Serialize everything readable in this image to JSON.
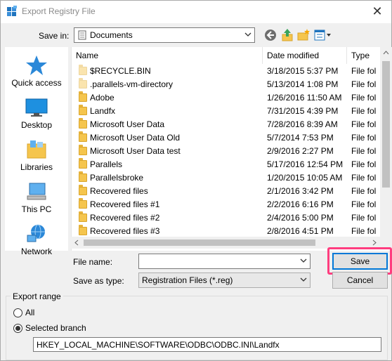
{
  "window": {
    "title": "Export Registry File",
    "close_symbol": "✕"
  },
  "save_in": {
    "label": "Save in:",
    "value": "Documents"
  },
  "places": [
    {
      "id": "quick-access",
      "label": "Quick access"
    },
    {
      "id": "desktop",
      "label": "Desktop"
    },
    {
      "id": "libraries",
      "label": "Libraries"
    },
    {
      "id": "this-pc",
      "label": "This PC"
    },
    {
      "id": "network",
      "label": "Network"
    }
  ],
  "columns": {
    "name": "Name",
    "date": "Date modified",
    "type": "Type"
  },
  "files": [
    {
      "name": "$RECYCLE.BIN",
      "date": "3/18/2015 5:37 PM",
      "type": "File fol",
      "hidden": true
    },
    {
      "name": ".parallels-vm-directory",
      "date": "5/13/2014 1:08 PM",
      "type": "File fol",
      "hidden": true
    },
    {
      "name": "Adobe",
      "date": "1/26/2016 11:50 AM",
      "type": "File fol",
      "hidden": false
    },
    {
      "name": "Landfx",
      "date": "7/31/2015 4:39 PM",
      "type": "File fol",
      "hidden": false
    },
    {
      "name": "Microsoft User Data",
      "date": "7/28/2016 8:39 AM",
      "type": "File fol",
      "hidden": false
    },
    {
      "name": "Microsoft User Data Old",
      "date": "5/7/2014 7:53 PM",
      "type": "File fol",
      "hidden": false
    },
    {
      "name": "Microsoft User Data test",
      "date": "2/9/2016 2:27 PM",
      "type": "File fol",
      "hidden": false
    },
    {
      "name": "Parallels",
      "date": "5/17/2016 12:54 PM",
      "type": "File fol",
      "hidden": false
    },
    {
      "name": "Parallelsbroke",
      "date": "1/20/2015 10:05 AM",
      "type": "File fol",
      "hidden": false
    },
    {
      "name": "Recovered files",
      "date": "2/1/2016 3:42 PM",
      "type": "File fol",
      "hidden": false
    },
    {
      "name": "Recovered files #1",
      "date": "2/2/2016 6:16 PM",
      "type": "File fol",
      "hidden": false
    },
    {
      "name": "Recovered files #2",
      "date": "2/4/2016 5:00 PM",
      "type": "File fol",
      "hidden": false
    },
    {
      "name": "Recovered files #3",
      "date": "2/8/2016 4:51 PM",
      "type": "File fol",
      "hidden": false
    }
  ],
  "file_name": {
    "label": "File name:",
    "value": ""
  },
  "save_as_type": {
    "label": "Save as type:",
    "value": "Registration Files (*.reg)"
  },
  "buttons": {
    "save": "Save",
    "cancel": "Cancel"
  },
  "export_range": {
    "title": "Export range",
    "all_label": "All",
    "selected_label": "Selected branch",
    "selected": "selected-branch",
    "branch_path": "HKEY_LOCAL_MACHINE\\SOFTWARE\\ODBC\\ODBC.INI\\Landfx"
  },
  "colors": {
    "highlight": "#ff3d7f",
    "default_button_border": "#0078d7",
    "folder": "#f5c54d"
  }
}
